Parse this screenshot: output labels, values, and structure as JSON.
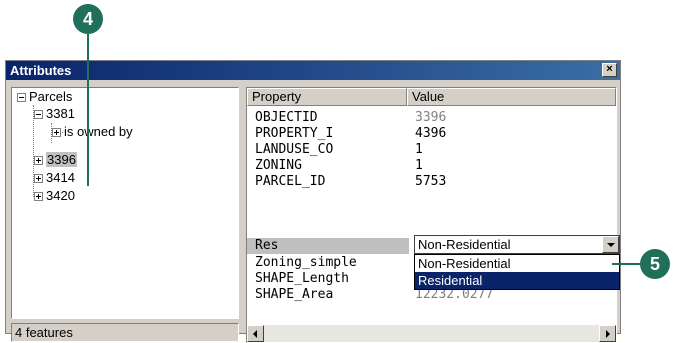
{
  "callouts": {
    "step_4": "4",
    "step_5": "5"
  },
  "window": {
    "title": "Attributes",
    "close_glyph": "×"
  },
  "tree": {
    "root": "Parcels",
    "nodes": [
      {
        "label": "3381",
        "expander": "minus"
      },
      {
        "label": "is owned by",
        "expander": "plus"
      },
      {
        "label": "3396",
        "expander": "plus"
      },
      {
        "label": "3414",
        "expander": "plus"
      },
      {
        "label": "3420",
        "expander": "plus"
      }
    ]
  },
  "status": {
    "text": "4 features"
  },
  "grid": {
    "headers": {
      "property": "Property",
      "value": "Value"
    },
    "rows": [
      {
        "property": "OBJECTID",
        "value": "3396",
        "muted": true
      },
      {
        "property": "PROPERTY_I",
        "value": "4396",
        "muted": false
      },
      {
        "property": "LANDUSE_CO",
        "value": "1",
        "muted": false
      },
      {
        "property": "ZONING",
        "value": "1",
        "muted": false
      },
      {
        "property": "PARCEL_ID",
        "value": "5753",
        "muted": false
      },
      {
        "property": "Res",
        "value": "",
        "muted": false
      },
      {
        "property": "Zoning_simple",
        "value": "",
        "muted": false
      },
      {
        "property": "SHAPE_Length",
        "value": "",
        "muted": false
      },
      {
        "property": "SHAPE_Area",
        "value": "12232.0277",
        "muted": true
      }
    ]
  },
  "res_dropdown": {
    "selected": "Non-Residential",
    "options": [
      "Non-Residential",
      "Residential"
    ],
    "highlighted": "Residential"
  },
  "colors": {
    "callout": "#1f6f5a",
    "titlebar": "#0a246a",
    "selection": "#0a246a"
  }
}
